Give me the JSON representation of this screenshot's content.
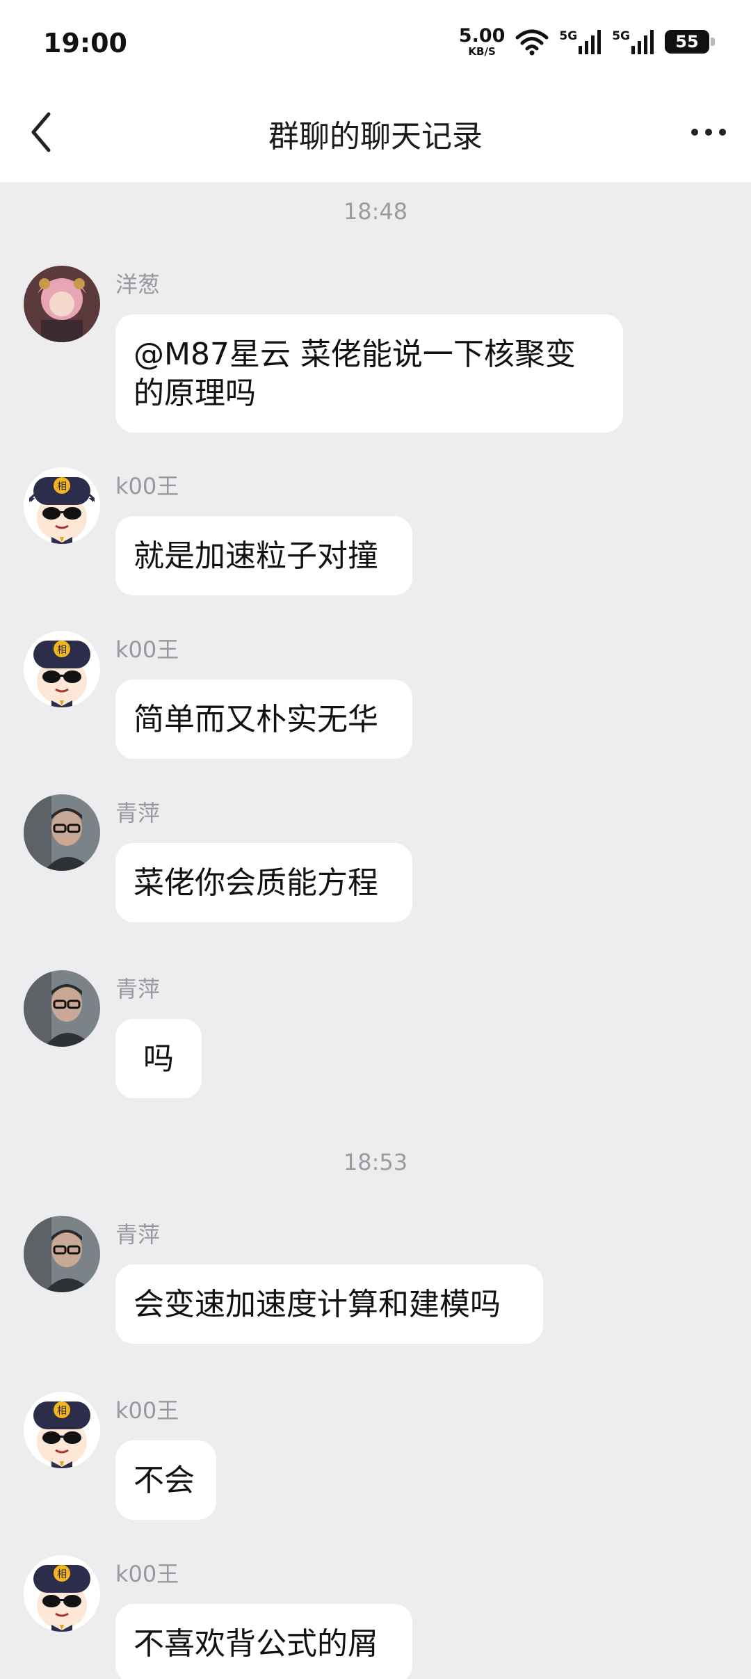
{
  "status_bar": {
    "time": "19:00",
    "speed_value": "5.00",
    "speed_unit": "KB/S",
    "net1": "5G",
    "net2": "5G",
    "battery": "55"
  },
  "nav": {
    "title": "群聊的聊天记录",
    "back_icon": "chevron-left-icon",
    "more_icon": "more-dots-icon"
  },
  "timestamps": [
    "18:48",
    "18:53"
  ],
  "messages": [
    {
      "sender": "洋葱",
      "text": "@M87星云 菜佬能说一下核聚变的原理吗",
      "avatar": "anime-girl-avatar"
    },
    {
      "sender": "k00王",
      "text": "就是加速粒子对撞",
      "avatar": "cartoon-boy-sunglasses-avatar"
    },
    {
      "sender": "k00王",
      "text": "简单而又朴实无华",
      "avatar": "cartoon-boy-sunglasses-avatar"
    },
    {
      "sender": "青萍",
      "text": "菜佬你会质能方程",
      "avatar": "man-glasses-avatar"
    },
    {
      "sender": "青萍",
      "text": "吗",
      "avatar": "man-glasses-avatar"
    },
    {
      "sender": "青萍",
      "text": "会变速加速度计算和建模吗",
      "avatar": "man-glasses-avatar"
    },
    {
      "sender": "k00王",
      "text": "不会",
      "avatar": "cartoon-boy-sunglasses-avatar"
    },
    {
      "sender": "k00王",
      "text": "不喜欢背公式的屑",
      "avatar": "cartoon-boy-sunglasses-avatar"
    }
  ],
  "avatar_badge": "相",
  "colors": {
    "background": "#EDEDF0",
    "bubble": "#FFFFFF",
    "meta_text": "#98989D",
    "topbar": "#FFFFFF"
  }
}
